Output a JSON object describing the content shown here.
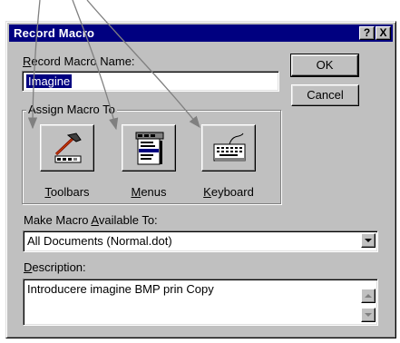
{
  "window": {
    "title": "Record Macro",
    "help_label": "?",
    "close_label": "X"
  },
  "name_section": {
    "label_prefix": "R",
    "label_rest": "ecord Macro Name:",
    "value": "Imagine"
  },
  "buttons": {
    "ok_label": "OK",
    "cancel_label": "Cancel"
  },
  "assign": {
    "group_title": "Assign Macro To",
    "toolbars": {
      "hotkey": "T",
      "rest": "oolbars"
    },
    "menus": {
      "hotkey": "M",
      "rest": "enus"
    },
    "keyboard": {
      "hotkey": "K",
      "rest": "eyboard"
    }
  },
  "available": {
    "label_before": "Make Macro ",
    "label_hotkey": "A",
    "label_after": "vailable To:",
    "selected": "All Documents (Normal.dot)"
  },
  "description": {
    "label_hotkey": "D",
    "label_rest": "escription:",
    "value": "Introducere imagine BMP prin Copy"
  },
  "icons": [
    "hammer-icon",
    "menu-icon",
    "keyboard-icon",
    "help-icon",
    "close-icon"
  ]
}
